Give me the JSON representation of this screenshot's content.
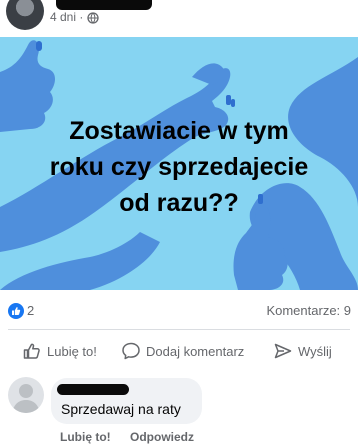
{
  "post": {
    "time": "4 dni",
    "time_separator": "·",
    "image_text": "Zostawiacie w tym\nroku  czy sprzedajecie\nod razu??",
    "reaction_count": "2",
    "comments_label": "Komentarze: 9"
  },
  "actions": {
    "like": "Lubię to!",
    "comment": "Dodaj komentarz",
    "share": "Wyślij"
  },
  "comment": {
    "text": "Sprzedawaj na raty",
    "like_label": "Lubię to!",
    "reply_label": "Odpowiedz"
  },
  "colors": {
    "image_background": "#86d4f2",
    "hand_shapes": "#4f8fdc",
    "like_badge": "#1877f2",
    "secondary_text": "#65676b"
  },
  "icons": {
    "privacy": "globe-icon",
    "reaction": "like-badge-icon",
    "like_action": "thumbs-up-icon",
    "comment_action": "speech-bubble-icon",
    "share_action": "send-arrow-icon"
  }
}
